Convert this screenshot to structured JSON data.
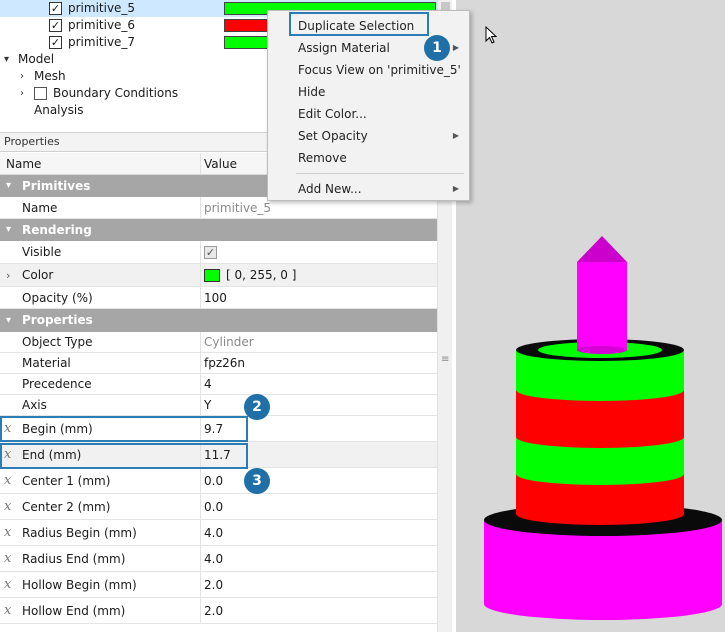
{
  "tree": {
    "items": [
      {
        "label": "primitive_5",
        "checked": true,
        "color": "#00ff00",
        "selected": true
      },
      {
        "label": "primitive_6",
        "checked": true,
        "color": "#ff0000",
        "selected": false
      },
      {
        "label": "primitive_7",
        "checked": true,
        "color": "#00ff00",
        "selected": false
      }
    ],
    "model": {
      "label": "Model",
      "children": [
        "Mesh",
        "Boundary Conditions",
        "Analysis"
      ]
    }
  },
  "properties": {
    "header": "Properties",
    "col_name": "Name",
    "col_value": "Value",
    "sections": {
      "primitives": "Primitives",
      "rendering": "Rendering",
      "properties": "Properties"
    },
    "rows": {
      "name": {
        "label": "Name",
        "value": "primitive_5"
      },
      "visible": {
        "label": "Visible",
        "checked": true
      },
      "color": {
        "label": "Color",
        "value": "[ 0, 255, 0 ]",
        "swatch": "#00ff00"
      },
      "opacity": {
        "label": "Opacity (%)",
        "value": "100"
      },
      "object_type": {
        "label": "Object Type",
        "value": "Cylinder"
      },
      "material": {
        "label": "Material",
        "value": "fpz26n"
      },
      "precedence": {
        "label": "Precedence",
        "value": "4"
      },
      "axis": {
        "label": "Axis",
        "value": "Y"
      },
      "begin": {
        "label": "Begin (mm)",
        "value": "9.7"
      },
      "end": {
        "label": "End (mm)",
        "value": "11.7"
      },
      "center1": {
        "label": "Center 1 (mm)",
        "value": "0.0"
      },
      "center2": {
        "label": "Center 2 (mm)",
        "value": "0.0"
      },
      "radius_begin": {
        "label": "Radius Begin (mm)",
        "value": "4.0"
      },
      "radius_end": {
        "label": "Radius End (mm)",
        "value": "4.0"
      },
      "hollow_begin": {
        "label": "Hollow Begin (mm)",
        "value": "2.0"
      },
      "hollow_end": {
        "label": "Hollow End (mm)",
        "value": "2.0"
      }
    }
  },
  "context_menu": {
    "items": [
      {
        "label": "Duplicate Selection",
        "submenu": false
      },
      {
        "label": "Assign Material",
        "submenu": true
      },
      {
        "label": "Focus View on 'primitive_5'",
        "submenu": false
      },
      {
        "label": "Hide",
        "submenu": false
      },
      {
        "label": "Edit Color...",
        "submenu": false
      },
      {
        "label": "Set Opacity",
        "submenu": true
      },
      {
        "label": "Remove",
        "submenu": false
      },
      {
        "label": "Add New...",
        "submenu": true
      }
    ]
  },
  "callouts": [
    "1",
    "2",
    "3"
  ],
  "icons": {
    "checkbox": "check-mark",
    "expander": "chevron-right-icon",
    "collapse": "chevron-down-icon",
    "expression": "x-expression-icon",
    "cursor": "mouse-pointer-icon"
  },
  "colors": {
    "green": "#00ff00",
    "red": "#ff0000",
    "magenta": "#ff00ff",
    "accent": "#2a7db5",
    "section_header": "#a6a6a6"
  }
}
